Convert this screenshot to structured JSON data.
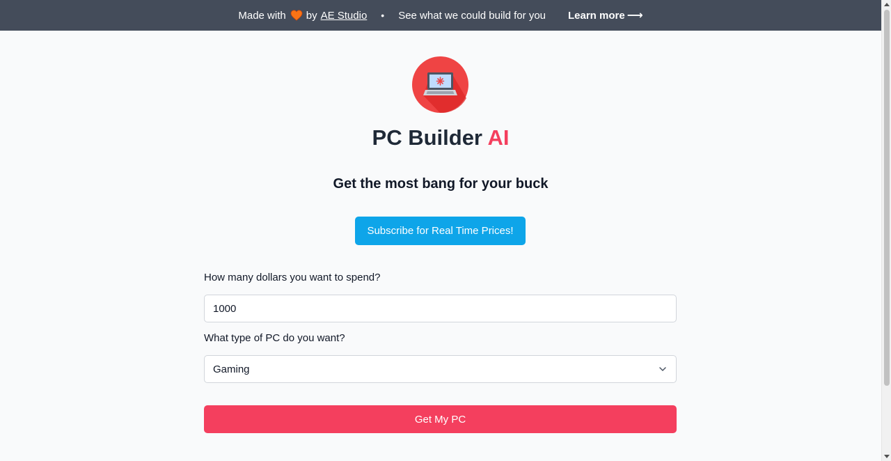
{
  "banner": {
    "made_with": "Made with",
    "by": "by",
    "studio": "AE Studio",
    "dot": "•",
    "pitch": "See what we could build for you",
    "learn_more": "Learn more",
    "arrow": "⟶",
    "heart_color": "#f97316"
  },
  "hero": {
    "logo_icon": "laptop-icon",
    "logo_bg": "#ef4444",
    "title": "PC Builder",
    "title_accent": "AI",
    "accent_color": "#f43f5e",
    "tagline": "Get the most bang for your buck",
    "subscribe_label": "Subscribe for Real Time Prices!"
  },
  "form": {
    "budget_label": "How many dollars you want to spend?",
    "budget_value": "1000",
    "type_label": "What type of PC do you want?",
    "type_value": "Gaming",
    "submit_label": "Get My PC"
  }
}
